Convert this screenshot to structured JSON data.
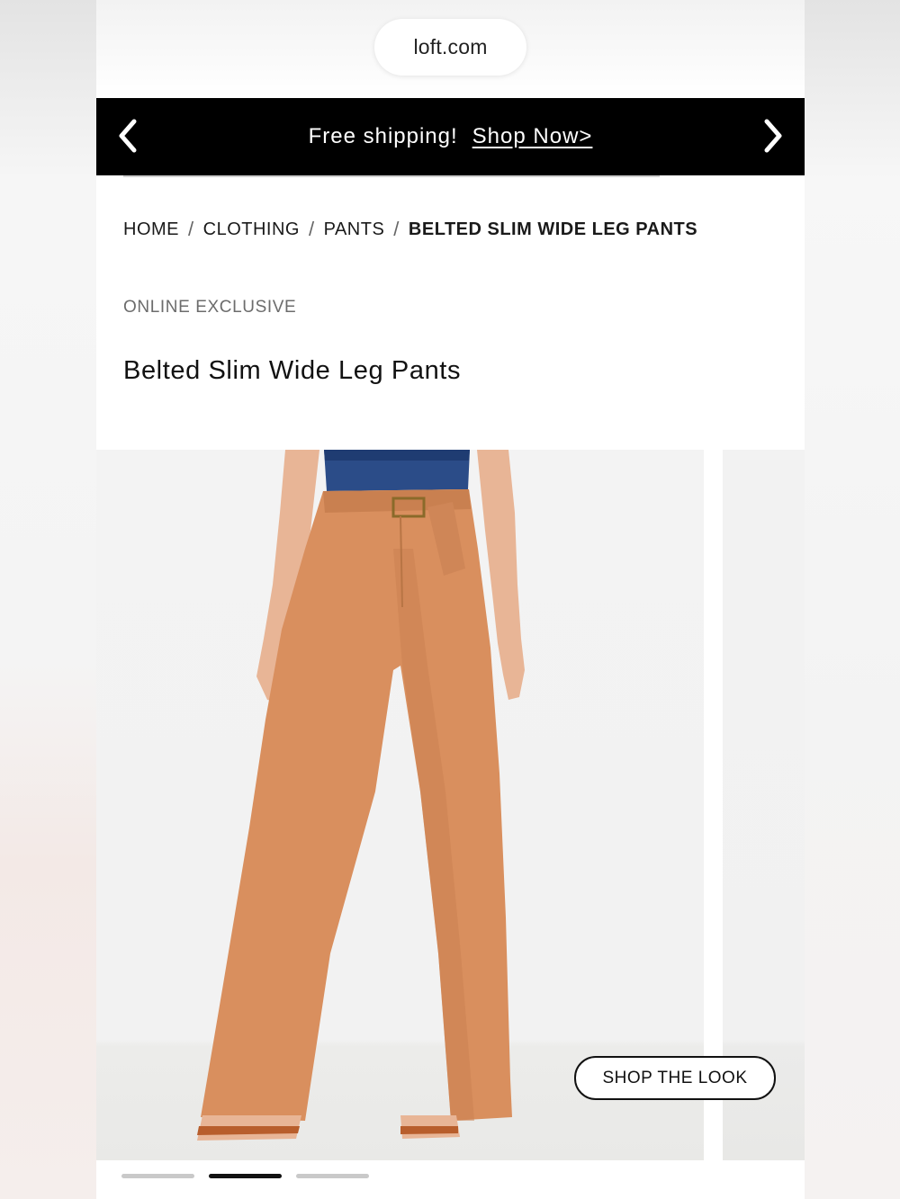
{
  "browser": {
    "url": "loft.com"
  },
  "promo": {
    "text": "Free shipping!",
    "link": "Shop Now>"
  },
  "breadcrumb": {
    "items": [
      "HOME",
      "CLOTHING",
      "PANTS"
    ],
    "separator": "/",
    "current": "BELTED SLIM WIDE LEG PANTS"
  },
  "product": {
    "badge": "ONLINE EXCLUSIVE",
    "title": "Belted Slim Wide Leg Pants"
  },
  "gallery": {
    "shop_the_look": "SHOP THE LOOK",
    "slide_count": 3,
    "active_slide": 2
  },
  "colors": {
    "promo_bg": "#000000",
    "pants": "#d98f5e",
    "top_denim": "#2a4a86"
  },
  "icons": [
    "chevron-left-icon",
    "chevron-right-icon"
  ]
}
